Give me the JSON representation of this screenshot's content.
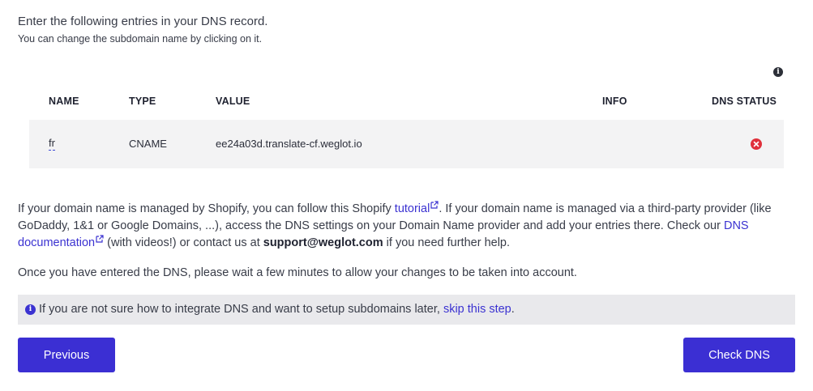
{
  "intro": {
    "title": "Enter the following entries in your DNS record.",
    "subtitle": "You can change the subdomain name by clicking on it."
  },
  "table": {
    "headers": {
      "name": "NAME",
      "type": "TYPE",
      "value": "VALUE",
      "info": "INFO",
      "status": "DNS STATUS"
    },
    "rows": [
      {
        "name": "fr",
        "type": "CNAME",
        "value": "ee24a03d.translate-cf.weglot.io",
        "info": "",
        "status": "error"
      }
    ]
  },
  "help": {
    "p1_a": "If your domain name is managed by Shopify, you can follow this Shopify ",
    "tutorial_link": "tutorial",
    "p1_b": ". If your domain name is managed via a third-party provider (like GoDaddy, 1&1 or Google Domains, ...), access the DNS settings on your Domain Name provider and add your entries there. Check our ",
    "dns_doc_link": "DNS documentation",
    "p1_c": " (with videos!) or contact us at ",
    "support_email": "support@weglot.com",
    "p1_d": " if you need further help.",
    "p2": "Once you have entered the DNS, please wait a few minutes to allow your changes to be taken into account."
  },
  "note": {
    "text": "If you are not sure how to integrate DNS and want to setup subdomains later, ",
    "skip_link": "skip this step",
    "end": "."
  },
  "buttons": {
    "previous": "Previous",
    "check_dns": "Check DNS"
  },
  "colors": {
    "accent": "#3b2fd3",
    "error": "#e0303b",
    "row_bg": "#f3f3f4",
    "note_bg": "#e9e9ec"
  },
  "icons": {
    "table_info": "info-icon",
    "status": "error-x-icon",
    "external": "external-link-icon",
    "note": "info-icon"
  }
}
